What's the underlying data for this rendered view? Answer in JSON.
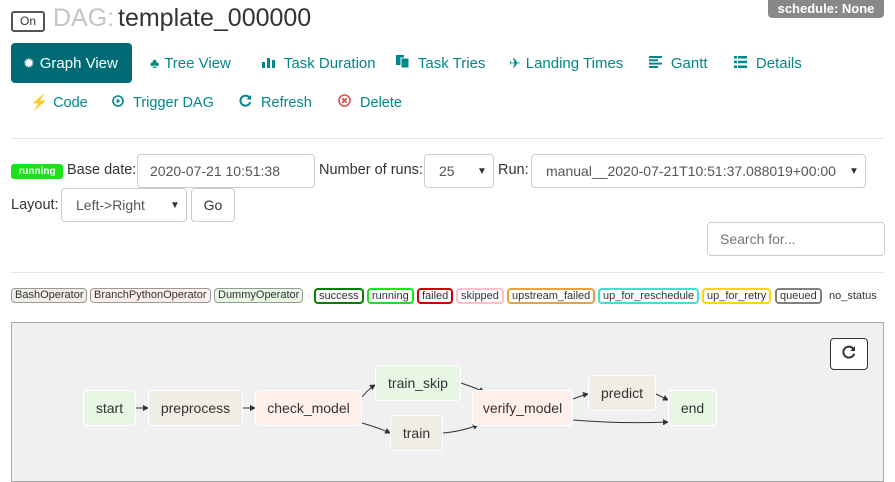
{
  "header": {
    "toggle_label": "On",
    "dag_prefix": "DAG:",
    "dag_name": "template_000000",
    "schedule": "schedule: None"
  },
  "nav": {
    "graph_view": "Graph View",
    "tree_view": "Tree View",
    "task_duration": "Task Duration",
    "task_tries": "Task Tries",
    "landing_times": "Landing Times",
    "gantt": "Gantt",
    "details": "Details",
    "code": "Code",
    "trigger_dag": "Trigger DAG",
    "refresh": "Refresh",
    "delete": "Delete"
  },
  "form": {
    "state_badge": "running",
    "base_date_label": "Base date:",
    "base_date_value": "2020-07-21 10:51:38",
    "num_runs_label": "Number of runs:",
    "num_runs_value": "25",
    "run_label": "Run:",
    "run_value": "manual__2020-07-21T10:51:37.088019+00:00",
    "layout_label": "Layout:",
    "layout_value": "Left->Right",
    "go_label": "Go",
    "search_placeholder": "Search for..."
  },
  "legend": {
    "operators": [
      "BashOperator",
      "BranchPythonOperator",
      "DummyOperator"
    ],
    "states": [
      "success",
      "running",
      "failed",
      "skipped",
      "upstream_failed",
      "up_for_reschedule",
      "up_for_retry",
      "queued",
      "no_status"
    ]
  },
  "graph": {
    "nodes": [
      "start",
      "preprocess",
      "check_model",
      "train_skip",
      "train",
      "verify_model",
      "predict",
      "end"
    ]
  },
  "colors": {
    "accent": "#006a75",
    "link": "#00888a",
    "running": "#1ae31a",
    "success": "#008000",
    "failed": "#d00000",
    "skipped": "#ffc0cb",
    "upstream_failed": "#e8a33a",
    "up_for_reschedule": "#40e0d0",
    "up_for_retry": "#ffd700",
    "queued": "#808080"
  }
}
